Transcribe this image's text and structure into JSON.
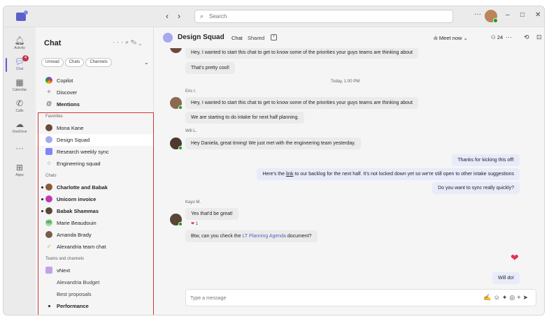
{
  "titlebar": {
    "search_placeholder": "Search",
    "more": "···",
    "minimize": "–",
    "restore": "□",
    "close": "✕"
  },
  "rail": {
    "items": [
      {
        "label": "Activity",
        "icon": "bell-icon"
      },
      {
        "label": "Chat",
        "icon": "chat-icon",
        "badge": "4"
      },
      {
        "label": "Calendar",
        "icon": "calendar-icon"
      },
      {
        "label": "Calls",
        "icon": "phone-icon"
      },
      {
        "label": "OneDrive",
        "icon": "cloud-icon"
      },
      {
        "label": "",
        "icon": "more-icon"
      },
      {
        "label": "Apps",
        "icon": "apps-icon"
      }
    ]
  },
  "chatlist": {
    "title": "Chat",
    "filters": [
      "Unread",
      "Chats",
      "Channels"
    ],
    "top_items": [
      {
        "label": "Copilot",
        "icon": "copilot-icon"
      },
      {
        "label": "Discover",
        "icon": "discover-icon"
      },
      {
        "label": "Mentions",
        "icon": "at-icon"
      }
    ],
    "favorites_label": "Favorites",
    "favorites": [
      {
        "label": "Mona Kane"
      },
      {
        "label": "Design Squad"
      },
      {
        "label": "Research weekly sync"
      },
      {
        "label": "Engineering squad"
      }
    ],
    "chats_label": "Chats",
    "chats": [
      {
        "label": "Charlotte and Babak"
      },
      {
        "label": "Unicorn invoice"
      },
      {
        "label": "Babak Shammas"
      },
      {
        "label": "Marie Beaudouin",
        "initials": "MB"
      },
      {
        "label": "Amanda Brady"
      },
      {
        "label": "Alexandria team chat"
      }
    ],
    "teams_label": "Teams and channels",
    "teams": [
      {
        "label": "vNext"
      },
      {
        "label": "Alexandria Budget"
      },
      {
        "label": "Best proposals"
      },
      {
        "label": "Performance"
      }
    ]
  },
  "chat": {
    "name": "Design Squad",
    "tabs": [
      "Chat",
      "Shared"
    ],
    "meet_now": "Meet now",
    "people_count": "24",
    "messages": {
      "m1": "Hey, I wanted to start this chat to get to know some of the priorities your guys teams are thinking about",
      "m2": "That's pretty cool!",
      "timestamp": "Today, 1:00 PM",
      "sender_eric": "Eric I.",
      "m3": "Hey, I wanted to start this chat to get to know some of the priorities your guys teams are thinking about",
      "m4": "We are starting to do intake for next half planning.",
      "sender_will": "Will L.",
      "m5": "Hey Daniela, great timing! We just met with the engineering team yesterday.",
      "o1": "Thanks for kicking this off!",
      "o2_pre": "Here's the ",
      "o2_link": "link",
      "o2_post": " to our backlog for the next half. It's not locked down yet so we're still open to other intake suggestions",
      "o3": "Do you want to sync really quickly?",
      "sender_kayo": "Kayo M.",
      "m6": "Yes that'd be great!",
      "reaction_count": "1",
      "m7_pre": "Btw, can you check the ",
      "m7_link": "LT Planning Agenda",
      "m7_post": " document?",
      "o4": "Will do!"
    },
    "composer_placeholder": "Type a message"
  },
  "colors": {
    "accent": "#5b5fc7",
    "highlight_border": "#d13438",
    "presence": "#13a10e"
  }
}
